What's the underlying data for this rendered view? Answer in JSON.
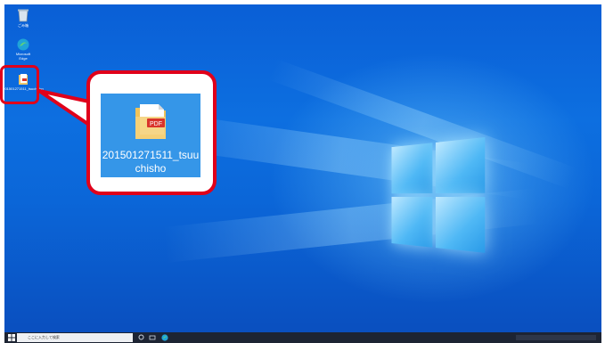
{
  "desktop": {
    "icons": [
      {
        "label": "ごみ箱",
        "icon": "recycle-bin-icon"
      },
      {
        "label": "Microsoft Edge",
        "icon": "edge-icon"
      },
      {
        "label": "201501271511_tsuchisho",
        "icon": "pdf-file-icon"
      }
    ]
  },
  "callout": {
    "file_icon": "pdf-file-icon",
    "badge": "PDF",
    "file_name": "201501271511_tsuuchisho"
  },
  "taskbar": {
    "search_placeholder": "ここに入力して検索",
    "icons": [
      "start-icon",
      "search-icon",
      "task-view-icon",
      "edge-icon"
    ]
  },
  "colors": {
    "callout_border": "#e0001a",
    "desktop_blue": "#0d6fe0",
    "selection": "#3596e8"
  }
}
